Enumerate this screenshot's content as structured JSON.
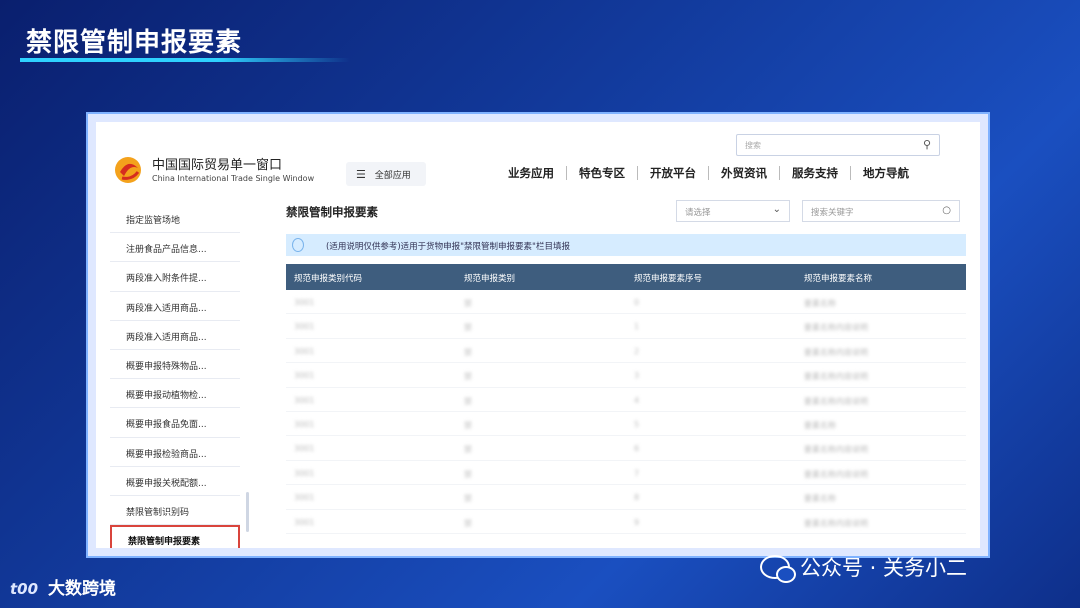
{
  "slide": {
    "title": "禁限管制申报要素",
    "brand_logo": "t00",
    "brand_name": "大数跨境",
    "wechat_caption": "公众号 · 关务小二"
  },
  "site": {
    "name_cn": "中国国际贸易单一窗口",
    "name_en": "China International Trade Single Window",
    "search_placeholder": "搜索",
    "all_apps_label": "全部应用",
    "nav": [
      "业务应用",
      "特色专区",
      "开放平台",
      "外贸资讯",
      "服务支持",
      "地方导航"
    ]
  },
  "sidebar": {
    "items": [
      "指定监管场地",
      "注册食品产品信息...",
      "两段准入附条件提...",
      "两段准入适用商品...",
      "两段准入适用商品...",
      "概要申报特殊物品...",
      "概要申报动植物检...",
      "概要申报食品免面...",
      "概要申报检验商品...",
      "概要申报关税配额...",
      "禁限管制识别码",
      "禁限管制申报要素"
    ],
    "active_index": 11
  },
  "content": {
    "title": "禁限管制申报要素",
    "select_placeholder": "请选择",
    "search_placeholder": "搜索关键字",
    "notice": "(适用说明仅供参考)适用于货物申报\"禁限管制申报要素\"栏目填报",
    "columns": [
      "规范申报类别代码",
      "规范申报类别",
      "规范申报要素序号",
      "规范申报要素名称"
    ],
    "rows": [
      [
        "3001",
        "禁",
        "0",
        "要素名称"
      ],
      [
        "3001",
        "禁",
        "1",
        "要素名称内容说明"
      ],
      [
        "3001",
        "禁",
        "2",
        "要素名称内容说明"
      ],
      [
        "3001",
        "禁",
        "3",
        "要素名称内容说明"
      ],
      [
        "3001",
        "禁",
        "4",
        "要素名称内容说明"
      ],
      [
        "3001",
        "禁",
        "5",
        "要素名称"
      ],
      [
        "3001",
        "禁",
        "6",
        "要素名称内容说明"
      ],
      [
        "3001",
        "禁",
        "7",
        "要素名称内容说明"
      ],
      [
        "3001",
        "禁",
        "8",
        "要素名称"
      ],
      [
        "3001",
        "禁",
        "9",
        "要素名称内容说明"
      ]
    ]
  }
}
